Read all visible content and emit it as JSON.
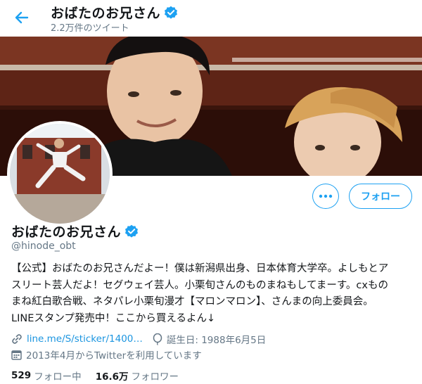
{
  "header": {
    "title": "おばたのお兄さん",
    "tweet_count": "2.2万件のツイート"
  },
  "profile": {
    "name": "おばたのお兄さん",
    "handle": "@hinode_obt",
    "bio_lines": [
      "【公式】おばたのお兄さんだよー！僕は新潟県出身、日本体育大学卒。よしもとア",
      "スリート芸人だよ！セグウェイ芸人。小栗旬さんのものまねもしてまーす。cxもの",
      "まね紅白歌合戦、ネタパレ小栗旬漫才【マロンマロン】、さんまの向上委員会。",
      "LINEスタンプ発売中！ここから買えるよん↓"
    ],
    "link_text": "line.me/S/sticker/1400…",
    "birthday": "誕生日: 1988年6月5日",
    "joined": "2013年4月からTwitterを利用しています"
  },
  "buttons": {
    "more_label": "•••",
    "follow_label": "フォロー"
  },
  "stats": {
    "following_count": "529",
    "following_label": "フォロー中",
    "followers_count": "16.6万",
    "followers_label": "フォロワー"
  },
  "icons": {
    "back": "back-arrow-icon",
    "verified": "verified-badge-icon",
    "link": "link-icon",
    "birthday": "balloon-icon",
    "calendar": "calendar-icon"
  },
  "colors": {
    "accent": "#1da1f2",
    "link": "#1b95e0",
    "muted": "#657786",
    "text": "#14171a"
  }
}
